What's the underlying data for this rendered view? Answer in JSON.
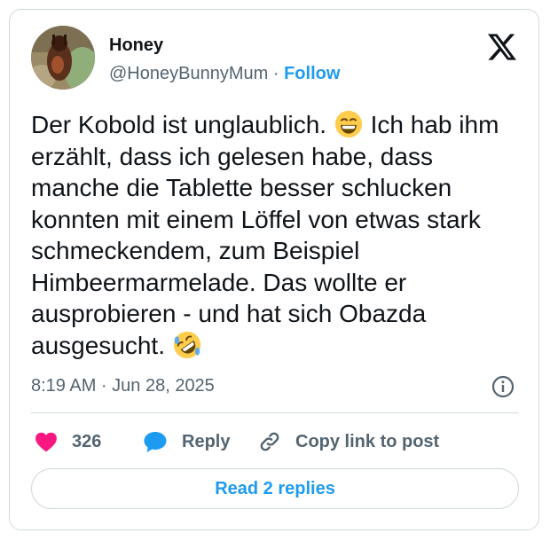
{
  "author": {
    "name": "Honey",
    "handle": "@HoneyBunnyMum",
    "separator": "·",
    "follow_label": "Follow"
  },
  "tweet": {
    "text_part1": "Der Kobold ist unglaublich. ",
    "text_part2": " Ich hab ihm erzählt, dass ich gelesen habe, dass manche die Tablette besser schlucken konnten mit einem Löffel von etwas stark schmeckendem, zum Beispiel Himbeermarmelade. Das wollte er ausprobieren - und hat sich Obazda ausgesucht. ",
    "emoji1": "grinning-squinting-face-emoji",
    "emoji2": "rolling-on-floor-laughing-emoji",
    "timestamp": "8:19 AM · Jun 28, 2025"
  },
  "actions": {
    "like_count": "326",
    "reply_label": "Reply",
    "copy_label": "Copy link to post"
  },
  "read_replies_label": "Read 2 replies",
  "icons": {
    "logo": "x-logo-icon",
    "like": "heart-icon",
    "reply": "speech-bubble-icon",
    "copy": "link-icon",
    "info": "info-icon"
  },
  "colors": {
    "like": "#f91880",
    "accent": "#1d9bf0",
    "secondary_text": "#536471",
    "border": "#cfd9de"
  }
}
